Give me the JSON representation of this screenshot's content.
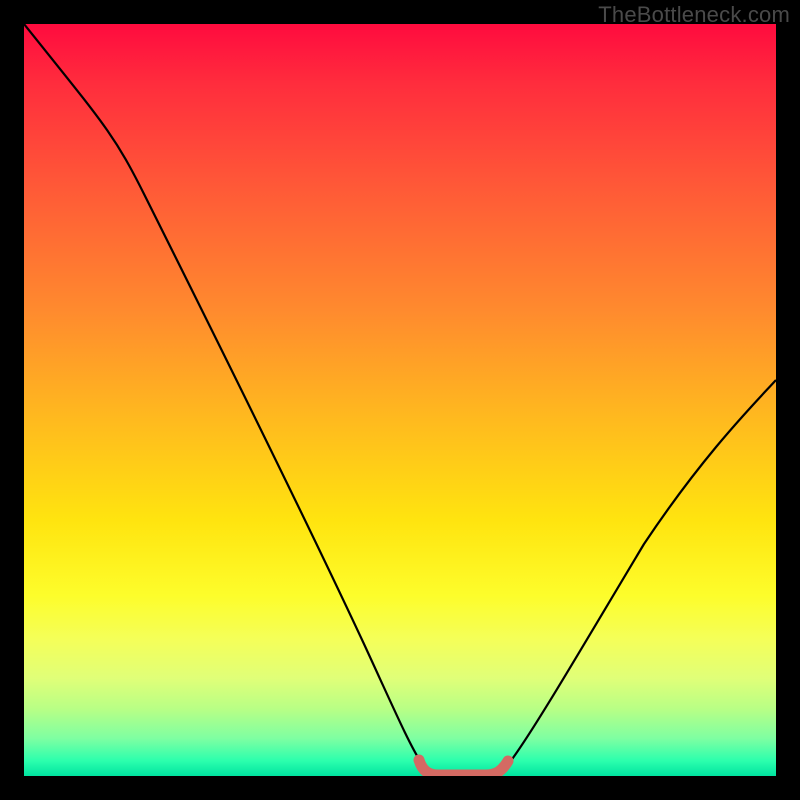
{
  "watermark": "TheBottleneck.com",
  "colors": {
    "background": "#000000",
    "curve_stroke": "#000000",
    "marker_stroke": "#d46a63",
    "gradient_top": "#ff0b3e",
    "gradient_bottom": "#00e3a0"
  },
  "chart_data": {
    "type": "line",
    "title": "",
    "xlabel": "",
    "ylabel": "",
    "xlim": [
      0,
      100
    ],
    "ylim": [
      0,
      100
    ],
    "x": [
      0,
      5,
      10,
      15,
      20,
      25,
      30,
      35,
      40,
      45,
      50,
      52,
      55,
      58,
      60,
      63,
      65,
      70,
      75,
      80,
      85,
      90,
      95,
      100
    ],
    "values": [
      100,
      91,
      81,
      71,
      61,
      51,
      41,
      31,
      21,
      11,
      3,
      1,
      0,
      0,
      0,
      1,
      3,
      10,
      18,
      26,
      34,
      41,
      47,
      53
    ],
    "series": [
      {
        "name": "bottleneck-curve",
        "x": [
          0,
          5,
          10,
          15,
          20,
          25,
          30,
          35,
          40,
          45,
          50,
          52,
          55,
          58,
          60,
          63,
          65,
          70,
          75,
          80,
          85,
          90,
          95,
          100
        ],
        "values": [
          100,
          91,
          81,
          71,
          61,
          51,
          41,
          31,
          21,
          11,
          3,
          1,
          0,
          0,
          0,
          1,
          3,
          10,
          18,
          26,
          34,
          41,
          47,
          53
        ]
      }
    ],
    "optimal_range_x": [
      52,
      63
    ],
    "annotations": []
  }
}
